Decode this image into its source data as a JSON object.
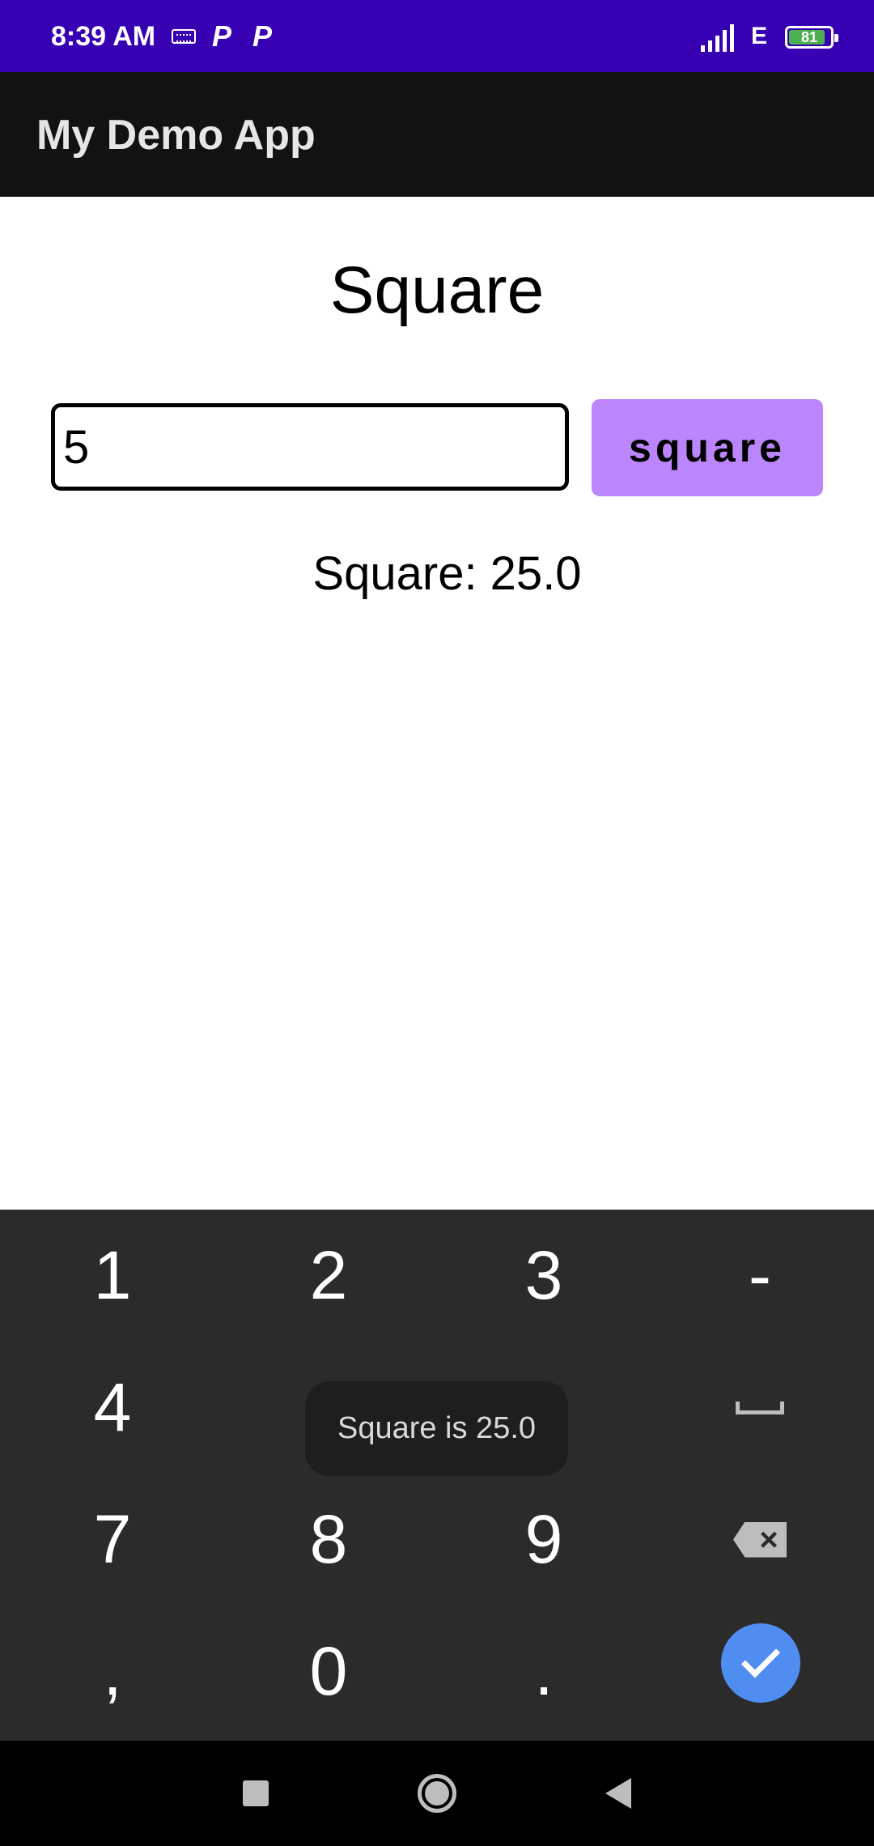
{
  "status_bar": {
    "time": "8:39 AM",
    "notification_icons": [
      "P",
      "P"
    ],
    "network_type": "E",
    "battery_level": "81",
    "battery_fraction": 0.81
  },
  "app_bar": {
    "title": "My Demo App"
  },
  "main": {
    "heading": "Square",
    "input_value": "5",
    "button_label": "square",
    "result_text": "Square: 25.0"
  },
  "toast": {
    "message": "Square is 25.0"
  },
  "keyboard": {
    "keys": {
      "k1": "1",
      "k2": "2",
      "k3": "3",
      "minus": "-",
      "k4": "4",
      "k7": "7",
      "k8": "8",
      "k9": "9",
      "comma": ",",
      "k0": "0",
      "period": "."
    },
    "special_keys": [
      "space-icon",
      "backspace-icon",
      "done-check-icon"
    ]
  },
  "nav_bar": {
    "buttons": [
      "recents-icon",
      "home-icon",
      "back-icon"
    ]
  },
  "colors": {
    "status_bar": "#3700b3",
    "app_bar": "#121212",
    "button": "#bb86fc",
    "keyboard": "#2b2b2b",
    "done_key": "#4f8df0"
  }
}
